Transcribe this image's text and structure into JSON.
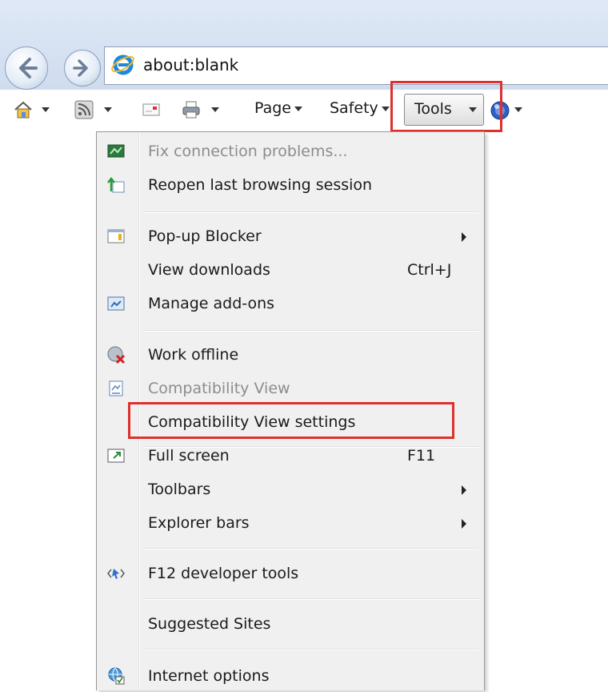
{
  "address_bar": {
    "url": "about:blank",
    "back_icon": "back-arrow-icon",
    "forward_icon": "forward-arrow-icon",
    "site_icon": "ie-logo-icon"
  },
  "command_bar": {
    "home_icon": "home-icon",
    "feeds_icon": "rss-feed-icon",
    "mail_icon": "read-mail-icon",
    "print_icon": "printer-icon",
    "page_label": "Page",
    "safety_label": "Safety",
    "tools_label": "Tools",
    "help_icon": "help-icon"
  },
  "tools_menu": {
    "items": [
      {
        "label": "Fix connection problems...",
        "icon": "network-diagnose-icon",
        "enabled": false
      },
      {
        "label": "Reopen last browsing session",
        "icon": "reopen-session-icon",
        "enabled": true
      },
      {
        "label": "Pop-up Blocker",
        "icon": "popup-blocker-icon",
        "submenu": true,
        "enabled": true
      },
      {
        "label": "View downloads",
        "shortcut": "Ctrl+J",
        "enabled": true
      },
      {
        "label": "Manage add-ons",
        "icon": "addons-icon",
        "enabled": true
      },
      {
        "label": "Work offline",
        "icon": "work-offline-icon",
        "enabled": true
      },
      {
        "label": "Compatibility View",
        "icon": "compatibility-view-icon",
        "enabled": false
      },
      {
        "label": "Compatibility View settings",
        "enabled": true
      },
      {
        "label": "Full screen",
        "icon": "full-screen-icon",
        "shortcut": "F11",
        "enabled": true
      },
      {
        "label": "Toolbars",
        "submenu": true,
        "enabled": true
      },
      {
        "label": "Explorer bars",
        "submenu": true,
        "enabled": true
      },
      {
        "label": "F12 developer tools",
        "icon": "developer-tools-icon",
        "enabled": true
      },
      {
        "label": "Suggested Sites",
        "enabled": true
      },
      {
        "label": "Internet options",
        "icon": "internet-options-icon",
        "enabled": true
      }
    ]
  },
  "highlight_color": "#e0302c"
}
